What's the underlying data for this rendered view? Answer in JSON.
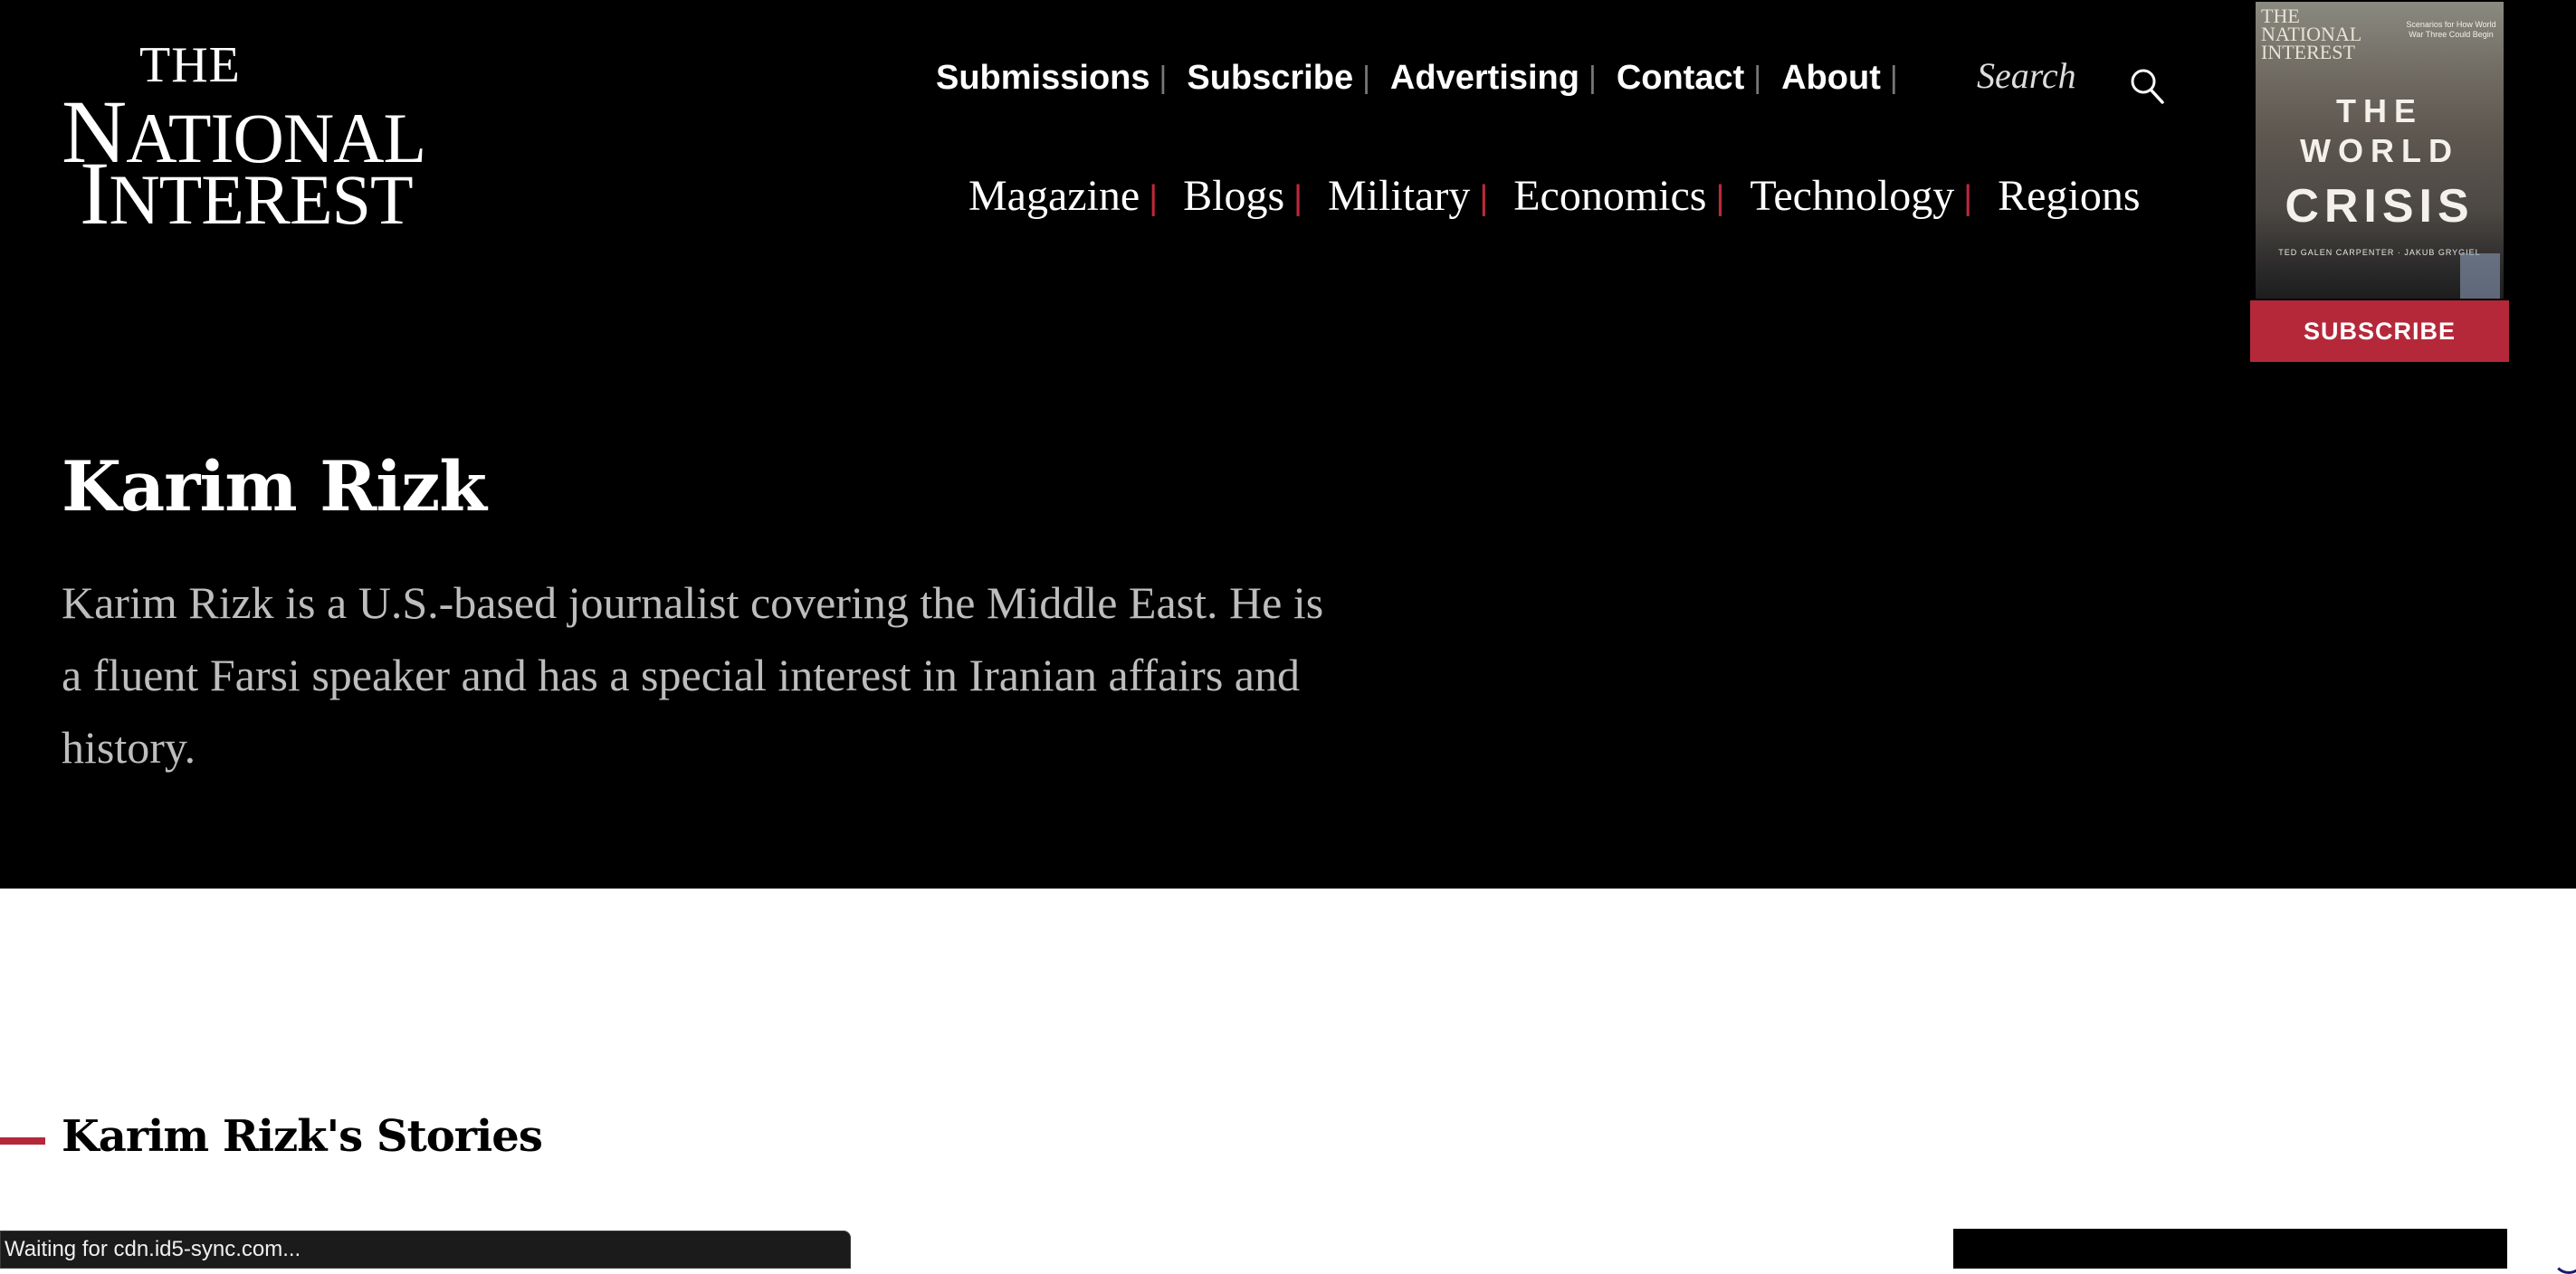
{
  "logo": {
    "the": "THE",
    "national_first": "N",
    "national_rest": "ATIONAL",
    "interest_first": "I",
    "interest_rest": "NTEREST"
  },
  "top_nav": {
    "items": [
      "Submissions",
      "Subscribe",
      "Advertising",
      "Contact",
      "About"
    ],
    "separator": "|"
  },
  "search": {
    "label": "Search",
    "icon": "search-icon"
  },
  "main_nav": {
    "items": [
      "Magazine",
      "Blogs",
      "Military",
      "Economics",
      "Technology",
      "Regions"
    ],
    "separator": "|"
  },
  "cover": {
    "masthead_line1": "THE",
    "masthead_line2": "NATIONAL",
    "masthead_line3": "INTEREST",
    "blurb": "Scenarios for How World War Three Could Begin",
    "title_line1": "THE",
    "title_line2": "WORLD",
    "title_line3": "CRISIS",
    "authors": "TED GALEN CARPENTER · JAKUB GRYGIEL"
  },
  "subscribe_button": "SUBSCRIBE",
  "author": {
    "name": "Karim Rizk",
    "bio": "Karim Rizk is a U.S.-based journalist covering the Middle East. He is a fluent Farsi speaker and has a special interest in Iranian affairs and history."
  },
  "stories": {
    "heading": "Karim Rizk's Stories"
  },
  "status_bar": {
    "text": "Waiting for cdn.id5-sync.com..."
  },
  "colors": {
    "accent": "#b5283a",
    "header_bg": "#000000",
    "bio_text": "#bdbdbd"
  }
}
